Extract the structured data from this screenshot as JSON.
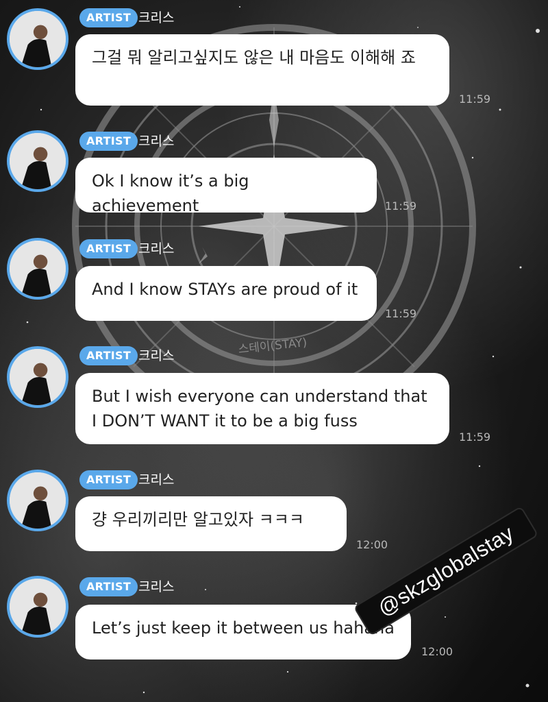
{
  "messages": [
    {
      "badge": "ARTIST",
      "sender": "크리스",
      "text": "그걸 뭐 알리고싶지도 않은 내 마음도 이해해 죠",
      "time": "11:59"
    },
    {
      "badge": "ARTIST",
      "sender": "크리스",
      "text": "Ok I know it’s a big achievement",
      "time": "11:59"
    },
    {
      "badge": "ARTIST",
      "sender": "크리스",
      "text": "And I know STAYs are proud of it",
      "time": "11:59"
    },
    {
      "badge": "ARTIST",
      "sender": "크리스",
      "text": "But I wish everyone can understand that I DON’T WANT it to be a big fuss",
      "time": "11:59"
    },
    {
      "badge": "ARTIST",
      "sender": "크리스",
      "text": "걍 우리끼리만 알고있자 ㅋㅋㅋ",
      "time": "12:00"
    },
    {
      "badge": "ARTIST",
      "sender": "크리스",
      "text": "Let’s just keep it between us hahaha",
      "time": "12:00"
    }
  ],
  "background": {
    "emblem_text": "스테이(STAY)"
  },
  "watermark": {
    "text": "@skzglobalstay"
  },
  "colors": {
    "accent": "#5aa8ea",
    "bubble": "#ffffff",
    "time": "#b9b9b9"
  }
}
